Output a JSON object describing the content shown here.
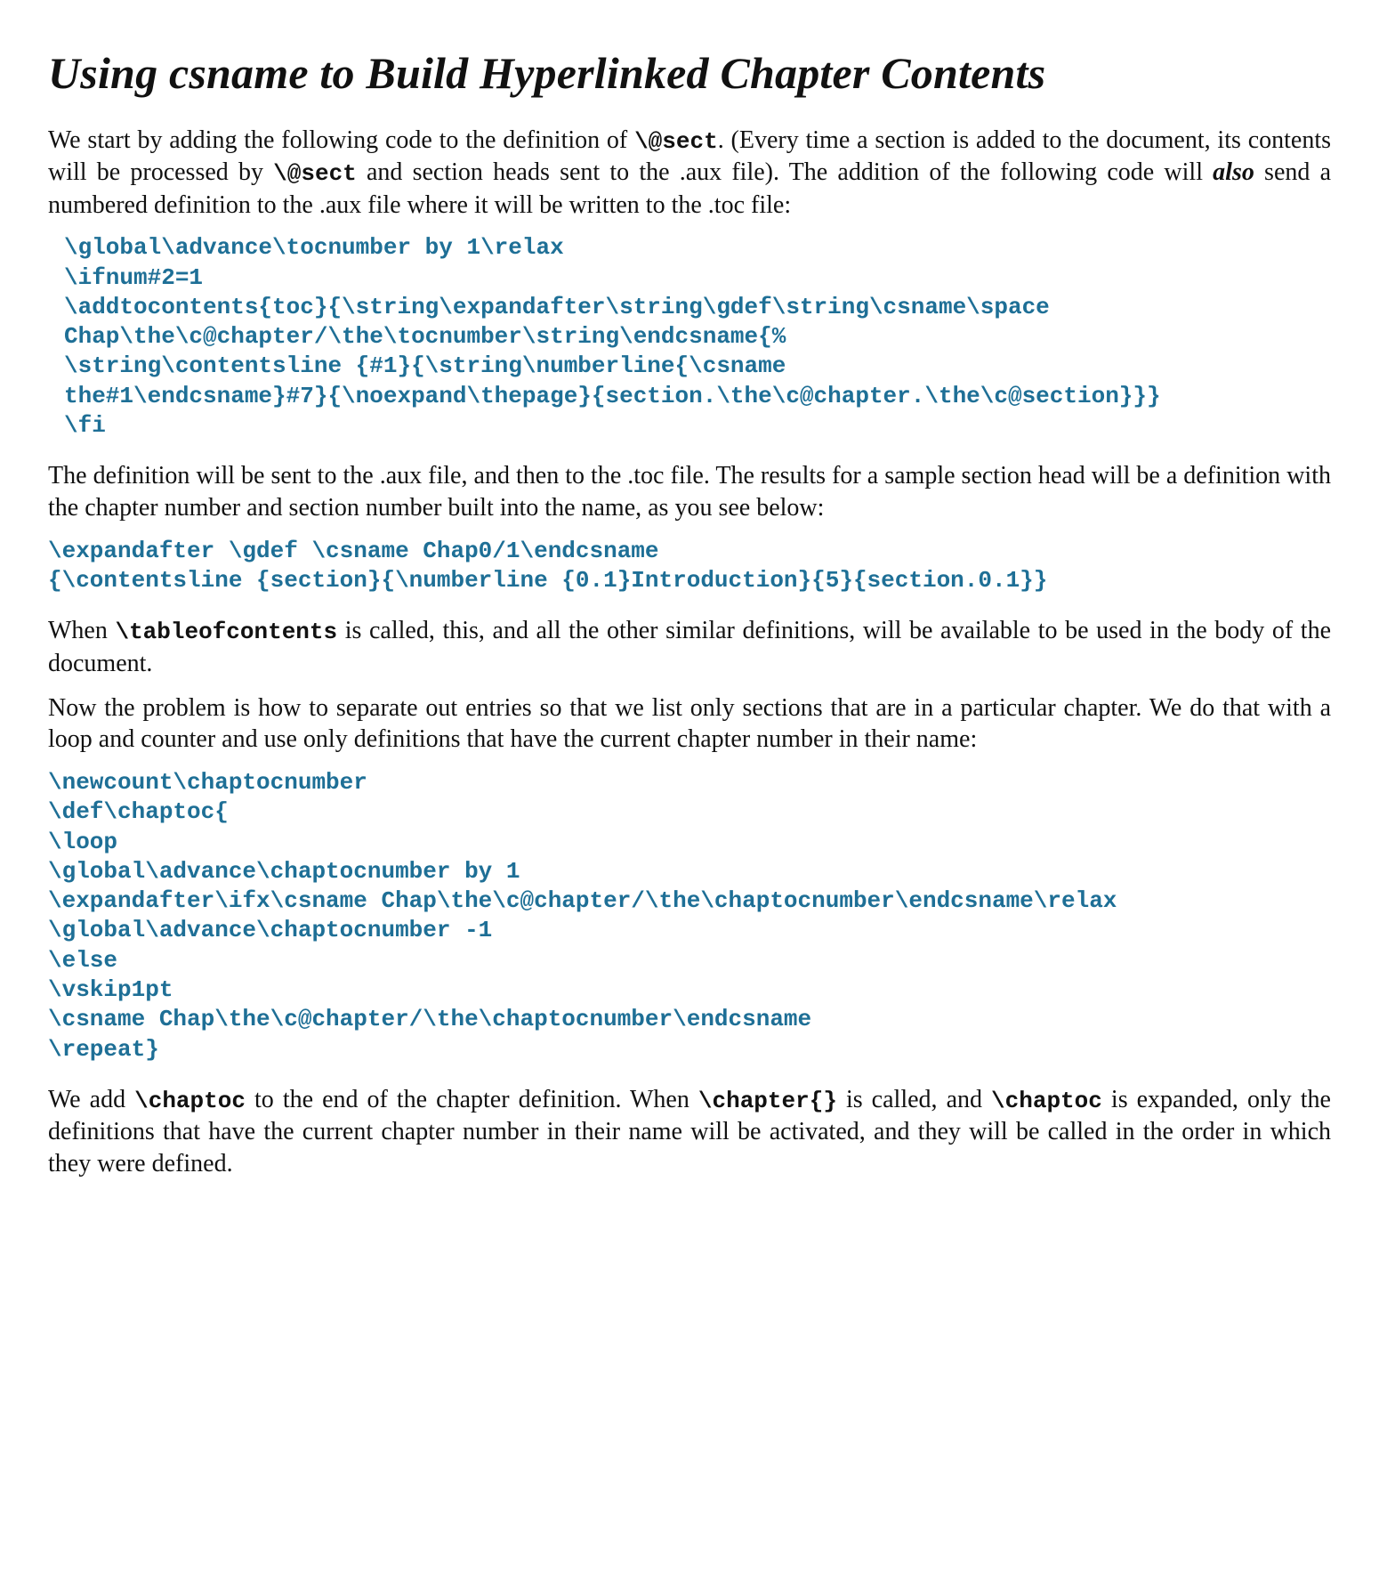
{
  "title": "Using csname to Build Hyperlinked Chapter Contents",
  "p1": {
    "seg1": "We start by adding the following code to the definition of ",
    "code1": "\\@sect",
    "seg2": ". (Every time a section is added to the document, its contents will be processed by ",
    "code2": "\\@sect",
    "seg3": " and section heads sent to the .aux file). The addition of the following code will ",
    "em1": "also",
    "seg4": " send a numbered definition to the .aux file where it will be written to the .toc file:"
  },
  "code1": "\\global\\advance\\tocnumber by 1\\relax\n\\ifnum#2=1\n\\addtocontents{toc}{\\string\\expandafter\\string\\gdef\\string\\csname\\space\nChap\\the\\c@chapter/\\the\\tocnumber\\string\\endcsname{%\n\\string\\contentsline {#1}{\\string\\numberline{\\csname\nthe#1\\endcsname}#7}{\\noexpand\\thepage}{section.\\the\\c@chapter.\\the\\c@section}}}\n\\fi",
  "p2": "The definition will be sent to the .aux file, and then to the .toc file. The results for a sample section head will be a definition with the chapter number and section number built into the name, as you see below:",
  "code2": "\\expandafter \\gdef \\csname Chap0/1\\endcsname\n{\\contentsline {section}{\\numberline {0.1}Introduction}{5}{section.0.1}}",
  "p3": {
    "seg1": "When ",
    "code1": "\\tableofcontents",
    "seg2": " is called, this, and all the other similar definitions, will be available to be used in the body of the document."
  },
  "p4": "Now the problem is how to separate out entries so that we list only sections that are in a particular chapter. We do that with a loop and counter and use only definitions that have the current chapter number in their name:",
  "code3": "\\newcount\\chaptocnumber\n\\def\\chaptoc{\n\\loop\n\\global\\advance\\chaptocnumber by 1\n\\expandafter\\ifx\\csname Chap\\the\\c@chapter/\\the\\chaptocnumber\\endcsname\\relax\n\\global\\advance\\chaptocnumber -1\n\\else\n\\vskip1pt\n\\csname Chap\\the\\c@chapter/\\the\\chaptocnumber\\endcsname\n\\repeat}",
  "p5": {
    "seg1": "We add ",
    "code1": "\\chaptoc",
    "seg2": " to the end of the chapter definition. When ",
    "code2": "\\chapter{}",
    "seg3": " is called, and ",
    "code3": "\\chaptoc",
    "seg4": " is expanded, only the definitions that have the current chapter number in their name will be activated, and they will be called in the order in which they were defined."
  }
}
